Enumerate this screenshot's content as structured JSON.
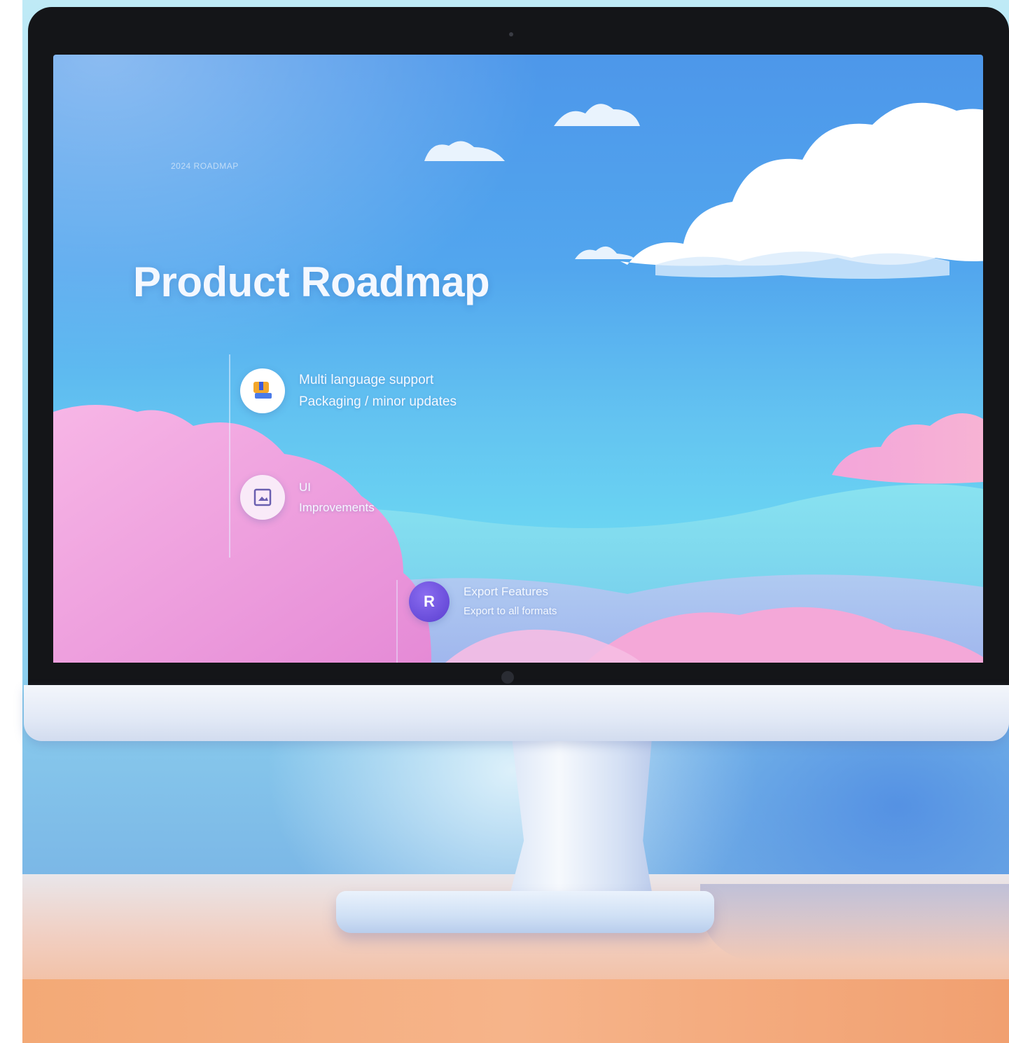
{
  "slide": {
    "small_label": "2024 ROADMAP",
    "title": "Product Roadmap"
  },
  "milestones": [
    {
      "icon": "package-icon",
      "line1": "Multi language support",
      "line2": "Packaging / minor updates"
    },
    {
      "icon": "image-icon",
      "line1": "UI",
      "line2": "Improvements"
    },
    {
      "icon": "r-letter-icon",
      "icon_letter": "R",
      "line1": "Export Features",
      "line2": "Export to all formats"
    }
  ],
  "colors": {
    "sky_top": "#4d97ea",
    "sky_bottom": "#6bd6f2",
    "cloud_pink": "#f0a6e0",
    "bezel": "#141518",
    "desk_edge": "#f3a976"
  }
}
